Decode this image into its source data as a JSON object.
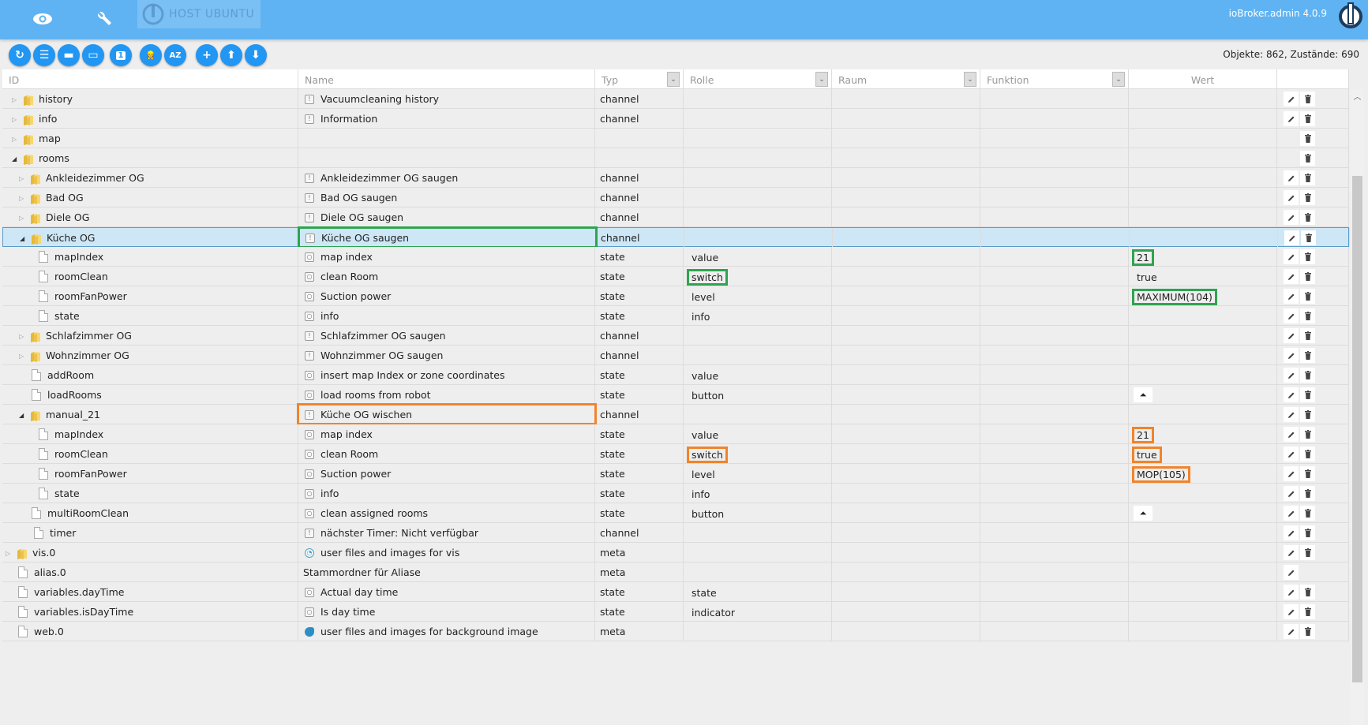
{
  "topbar": {
    "nav_icons": [
      "eye-icon",
      "wrench-icon"
    ],
    "host_label": "HOST UBUNTU",
    "version": "ioBroker.admin 4.0.9",
    "brand_color": "#5fb3f2"
  },
  "toolbar": {
    "buttons": [
      {
        "name": "refresh",
        "glyph": "↻"
      },
      {
        "name": "list-view",
        "glyph": "☰"
      },
      {
        "name": "collapse-all",
        "glyph": "▬"
      },
      {
        "name": "expand-all",
        "glyph": "▭"
      },
      {
        "name": "expand-level",
        "glyph": "1"
      },
      {
        "name": "expert-mode",
        "glyph": "👷"
      },
      {
        "name": "sort-az",
        "glyph": "AZ"
      },
      {
        "name": "add-object",
        "glyph": "+"
      },
      {
        "name": "upload",
        "glyph": "⬆"
      },
      {
        "name": "download",
        "glyph": "⬇"
      }
    ],
    "accent_color": "#2196f3",
    "counts_text": "Objekte: 862, Zustände: 690"
  },
  "columns": {
    "id": "ID",
    "name": "Name",
    "typ": "Typ",
    "rolle": "Rolle",
    "raum": "Raum",
    "funktion": "Funktion",
    "wert": "Wert"
  },
  "rows": [
    {
      "id": "history",
      "icon": "folder",
      "toggle": "closed",
      "indent": 0,
      "name_icon": "channel",
      "name": "Vacuumcleaning history",
      "typ": "channel",
      "role": "",
      "value": "",
      "edit": true,
      "del": true
    },
    {
      "id": "info",
      "icon": "folder",
      "toggle": "closed",
      "indent": 0,
      "name_icon": "channel",
      "name": "Information",
      "typ": "channel",
      "role": "",
      "value": "",
      "edit": true,
      "del": true
    },
    {
      "id": "map",
      "icon": "folder",
      "toggle": "closed",
      "indent": 0,
      "name_icon": "",
      "name": "",
      "typ": "",
      "role": "",
      "value": "",
      "edit": false,
      "del": true
    },
    {
      "id": "rooms",
      "icon": "folder",
      "toggle": "open",
      "indent": 0,
      "name_icon": "",
      "name": "",
      "typ": "",
      "role": "",
      "value": "",
      "edit": false,
      "del": true
    },
    {
      "id": "Ankleidezimmer OG",
      "icon": "folder",
      "toggle": "closed",
      "indent": 1,
      "name_icon": "channel",
      "name": "Ankleidezimmer OG saugen",
      "typ": "channel",
      "role": "",
      "value": "",
      "edit": true,
      "del": true
    },
    {
      "id": "Bad OG",
      "icon": "folder",
      "toggle": "closed",
      "indent": 1,
      "name_icon": "channel",
      "name": "Bad OG saugen",
      "typ": "channel",
      "role": "",
      "value": "",
      "edit": true,
      "del": true
    },
    {
      "id": "Diele OG",
      "icon": "folder",
      "toggle": "closed",
      "indent": 1,
      "name_icon": "channel",
      "name": "Diele OG saugen",
      "typ": "channel",
      "role": "",
      "value": "",
      "edit": true,
      "del": true
    },
    {
      "id": "Küche OG",
      "icon": "folder",
      "toggle": "open",
      "indent": 1,
      "selected": true,
      "name_icon": "channel",
      "name": "Küche OG saugen",
      "name_hl": "green",
      "typ": "channel",
      "role": "",
      "value": "",
      "edit": true,
      "del": true
    },
    {
      "id": "mapIndex",
      "icon": "file",
      "toggle": "",
      "indent": 2,
      "name_icon": "state",
      "name": "map index",
      "typ": "state",
      "role": "value",
      "value": "21",
      "value_hl": "green",
      "edit": true,
      "del": true
    },
    {
      "id": "roomClean",
      "icon": "file",
      "toggle": "",
      "indent": 2,
      "name_icon": "state",
      "name": "clean Room",
      "typ": "state",
      "role": "switch",
      "role_hl": "green",
      "value": "true",
      "edit": true,
      "del": true
    },
    {
      "id": "roomFanPower",
      "icon": "file",
      "toggle": "",
      "indent": 2,
      "name_icon": "state",
      "name": "Suction power",
      "typ": "state",
      "role": "level",
      "value": "MAXIMUM(104)",
      "value_hl": "green",
      "edit": true,
      "del": true
    },
    {
      "id": "state",
      "icon": "file",
      "toggle": "",
      "indent": 2,
      "name_icon": "state",
      "name": "info",
      "typ": "state",
      "role": "info",
      "value": "",
      "edit": true,
      "del": true
    },
    {
      "id": "Schlafzimmer OG",
      "icon": "folder",
      "toggle": "closed",
      "indent": 1,
      "name_icon": "channel",
      "name": "Schlafzimmer OG saugen",
      "typ": "channel",
      "role": "",
      "value": "",
      "edit": true,
      "del": true
    },
    {
      "id": "Wohnzimmer OG",
      "icon": "folder",
      "toggle": "closed",
      "indent": 1,
      "name_icon": "channel",
      "name": "Wohnzimmer OG saugen",
      "typ": "channel",
      "role": "",
      "value": "",
      "edit": true,
      "del": true
    },
    {
      "id": "addRoom",
      "icon": "file",
      "toggle": "",
      "indent": 1,
      "name_icon": "state",
      "name": "insert map Index or zone coordinates",
      "typ": "state",
      "role": "value",
      "value": "",
      "edit": true,
      "del": true
    },
    {
      "id": "loadRooms",
      "icon": "file",
      "toggle": "",
      "indent": 1,
      "name_icon": "state",
      "name": "load rooms from robot",
      "typ": "state",
      "role": "button",
      "value": "",
      "value_button": true,
      "edit": true,
      "del": true
    },
    {
      "id": "manual_21",
      "icon": "folder",
      "toggle": "open",
      "indent": 1,
      "name_icon": "channel",
      "name": "Küche OG wischen",
      "name_hl": "orange",
      "typ": "channel",
      "role": "",
      "value": "",
      "edit": true,
      "del": true
    },
    {
      "id": "mapIndex",
      "icon": "file",
      "toggle": "",
      "indent": 2,
      "name_icon": "state",
      "name": "map index",
      "typ": "state",
      "role": "value",
      "value": "21",
      "value_hl": "orange",
      "edit": true,
      "del": true
    },
    {
      "id": "roomClean",
      "icon": "file",
      "toggle": "",
      "indent": 2,
      "name_icon": "state",
      "name": "clean Room",
      "typ": "state",
      "role": "switch",
      "role_hl": "orange",
      "value": "true",
      "value_hl": "orange",
      "edit": true,
      "del": true
    },
    {
      "id": "roomFanPower",
      "icon": "file",
      "toggle": "",
      "indent": 2,
      "name_icon": "state",
      "name": "Suction power",
      "typ": "state",
      "role": "level",
      "value": "MOP(105)",
      "value_hl": "orange",
      "edit": true,
      "del": true
    },
    {
      "id": "state",
      "icon": "file",
      "toggle": "",
      "indent": 2,
      "name_icon": "state",
      "name": "info",
      "typ": "state",
      "role": "info",
      "value": "",
      "edit": true,
      "del": true
    },
    {
      "id": "multiRoomClean",
      "icon": "file",
      "toggle": "",
      "indent": 1,
      "name_icon": "state",
      "name": "clean assigned rooms",
      "typ": "state",
      "role": "button",
      "value": "",
      "value_button": true,
      "edit": true,
      "del": true
    },
    {
      "id": "timer",
      "icon": "file",
      "toggle": "",
      "indent": 0.5,
      "name_icon": "channel",
      "name": "nächster Timer: Nicht verfügbar",
      "typ": "channel",
      "role": "",
      "value": "",
      "edit": true,
      "del": true
    },
    {
      "id": "vis.0",
      "icon": "folder",
      "toggle": "closed",
      "indent": -1,
      "name_icon": "vis",
      "name": "user files and images for vis",
      "typ": "meta",
      "role": "",
      "value": "",
      "edit": true,
      "del": true
    },
    {
      "id": "alias.0",
      "icon": "file",
      "toggle": "",
      "indent": -1,
      "name_icon": "",
      "name": "Stammordner für Aliase",
      "typ": "meta",
      "role": "",
      "value": "",
      "edit": true,
      "del": false
    },
    {
      "id": "variables.dayTime",
      "icon": "file",
      "toggle": "",
      "indent": -1,
      "name_icon": "state",
      "name": "Actual day time",
      "typ": "state",
      "role": "state",
      "value": "",
      "edit": true,
      "del": true
    },
    {
      "id": "variables.isDayTime",
      "icon": "file",
      "toggle": "",
      "indent": -1,
      "name_icon": "state",
      "name": "Is day time",
      "typ": "state",
      "role": "indicator",
      "value": "",
      "edit": true,
      "del": true
    },
    {
      "id": "web.0",
      "icon": "file",
      "toggle": "",
      "indent": -1,
      "name_icon": "web",
      "name": "user files and images for background image",
      "typ": "meta",
      "role": "",
      "value": "",
      "edit": true,
      "del": true
    }
  ],
  "button_value_glyph": "⏶",
  "highlight_colors": {
    "green": "#2ea44f",
    "orange": "#f0842c"
  }
}
